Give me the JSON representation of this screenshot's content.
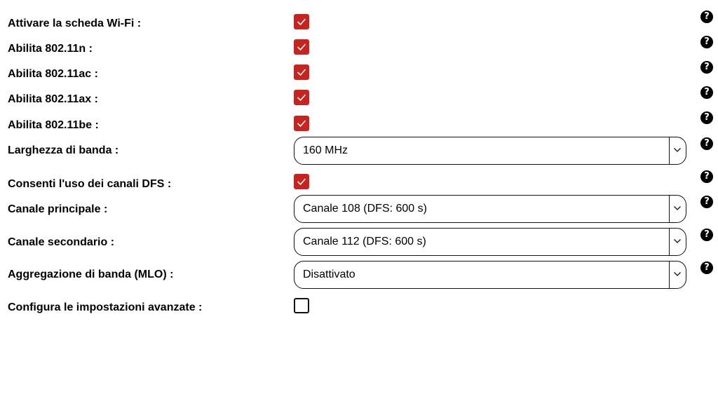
{
  "rows": [
    {
      "label": "Attivare la scheda Wi-Fi :",
      "type": "checkbox",
      "checked": true
    },
    {
      "label": "Abilita 802.11n :",
      "type": "checkbox",
      "checked": true
    },
    {
      "label": "Abilita 802.11ac :",
      "type": "checkbox",
      "checked": true
    },
    {
      "label": "Abilita 802.11ax :",
      "type": "checkbox",
      "checked": true
    },
    {
      "label": "Abilita 802.11be :",
      "type": "checkbox",
      "checked": true
    },
    {
      "label": "Larghezza di banda :",
      "type": "select",
      "value": "160 MHz"
    },
    {
      "label": "Consenti l'uso dei canali DFS :",
      "type": "checkbox",
      "checked": true
    },
    {
      "label": "Canale principale :",
      "type": "select",
      "value": "Canale 108 (DFS: 600 s)"
    },
    {
      "label": "Canale secondario :",
      "type": "select",
      "value": "Canale 112 (DFS: 600 s)"
    },
    {
      "label": "Aggregazione di banda (MLO) :",
      "type": "select",
      "value": "Disattivato"
    },
    {
      "label": "Configura le impostazioni avanzate :",
      "type": "checkbox",
      "checked": false
    }
  ],
  "help_icon": {
    "glyph": "?",
    "icon": "question-circle-icon"
  },
  "colors": {
    "checkbox_checked": "#c8231e",
    "text": "#000000",
    "background": "#ffffff"
  }
}
